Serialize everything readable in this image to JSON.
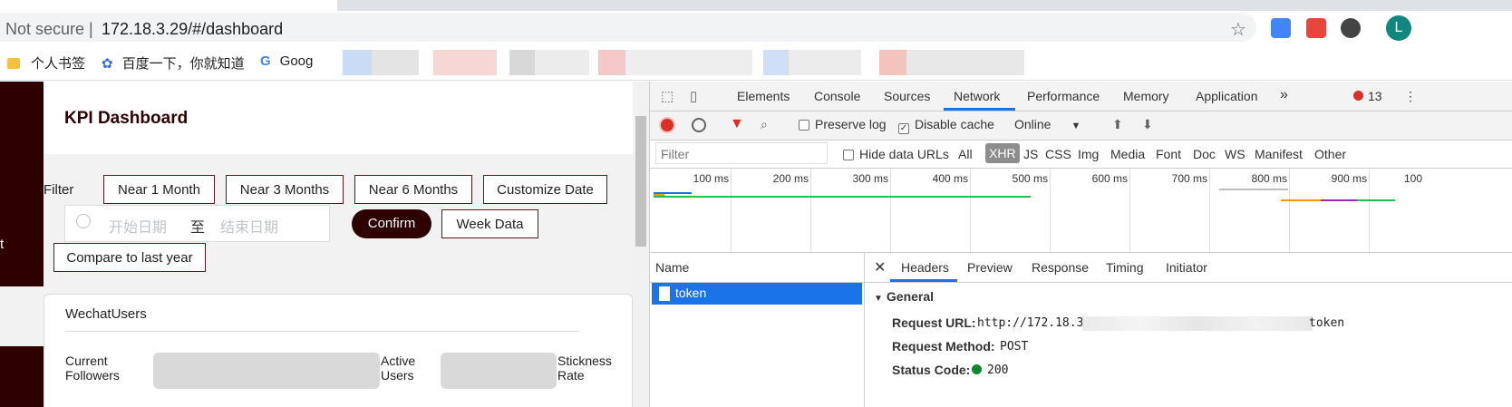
{
  "browser": {
    "security_label": "Not secure  |",
    "url": "172.18.3.29/#/dashboard",
    "avatar_letter": "L",
    "bookmarks": [
      "个人书签",
      "百度一下，你就知道",
      "Goog"
    ]
  },
  "page": {
    "sidebar_text": "t",
    "title": "KPI Dashboard",
    "filter_label": "Filter",
    "filter_buttons": [
      "Near 1 Month",
      "Near 3 Months",
      "Near 6 Months",
      "Customize Date"
    ],
    "date_range": {
      "start_placeholder": "开始日期",
      "separator": "至",
      "end_placeholder": "结束日期"
    },
    "confirm_label": "Confirm",
    "week_data_label": "Week Data",
    "compare_label": "Compare to last year",
    "wechat": {
      "title": "WechatUsers",
      "metrics": [
        "Current Followers",
        "Active Users",
        "Stickness Rate"
      ]
    }
  },
  "devtools": {
    "tabs": [
      "Elements",
      "Console",
      "Sources",
      "Network",
      "Performance",
      "Memory",
      "Application"
    ],
    "active_tab": "Network",
    "more_tabs": "»",
    "error_count": "13",
    "toolbar": {
      "preserve_log": "Preserve log",
      "preserve_log_checked": false,
      "disable_cache": "Disable cache",
      "disable_cache_checked": true,
      "throttle": "Online"
    },
    "filter": {
      "placeholder": "Filter",
      "hide_data_urls": "Hide data URLs",
      "types": [
        "All",
        "XHR",
        "JS",
        "CSS",
        "Img",
        "Media",
        "Font",
        "Doc",
        "WS",
        "Manifest",
        "Other"
      ],
      "active_type": "XHR"
    },
    "timeline_labels": [
      "100 ms",
      "200 ms",
      "300 ms",
      "400 ms",
      "500 ms",
      "600 ms",
      "700 ms",
      "800 ms",
      "900 ms",
      "100"
    ],
    "requests": {
      "column": "Name",
      "items": [
        "token"
      ]
    },
    "detail": {
      "tabs": [
        "Headers",
        "Preview",
        "Response",
        "Timing",
        "Initiator"
      ],
      "active": "Headers",
      "section": "General",
      "request_url_key": "Request URL:",
      "request_url_prefix": "http://172.18.3",
      "request_url_suffix": "token",
      "request_method_key": "Request Method:",
      "request_method": "POST",
      "status_code_key": "Status Code:",
      "status_code": "200"
    }
  },
  "colors": {
    "brand": "#2e0000",
    "devtools_accent": "#1a73e8",
    "status_ok": "#0a8a2d",
    "record": "#d93025"
  }
}
